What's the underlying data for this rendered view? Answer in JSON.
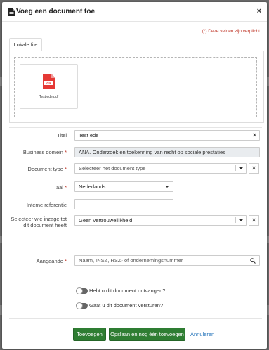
{
  "modal": {
    "title": "Voeg een document toe",
    "close_label": "×",
    "required_note": "(*) Deze velden zijn verplicht"
  },
  "tabs": [
    {
      "label": "Lokale file",
      "active": true
    }
  ],
  "upload": {
    "file_name": "Test ede.pdf",
    "file_badge": "PDF"
  },
  "form": {
    "titel": {
      "label": "Titel",
      "value": "Test ede",
      "clear": "×"
    },
    "business_domein": {
      "label": "Business domein",
      "required": "*",
      "value": "ANA. Onderzoek en toekenning van recht op sociale prestaties"
    },
    "document_type": {
      "label": "Document type",
      "required": "*",
      "placeholder": "Selecteer het document type",
      "clear": "×"
    },
    "taal": {
      "label": "Taal",
      "required": "*",
      "value": "Nederlands"
    },
    "interne_referentie": {
      "label": "Interne referentie",
      "value": ""
    },
    "inzage": {
      "label_line1": "Selecteer wie inzage tot",
      "label_line2": "dit document heeft",
      "value": "Geen vertrouwelijkheid",
      "clear": "×"
    },
    "aangaande": {
      "label": "Aangaande",
      "required": "*",
      "placeholder": "Naam, INSZ, RSZ- of ondernemingsnummer"
    }
  },
  "toggles": [
    {
      "label": "Hebt u dit document ontvangen?",
      "on": false
    },
    {
      "label": "Gaat u dit document versturen?",
      "on": false
    }
  ],
  "footer": {
    "add_label": "Toevoegen",
    "save_add_label": "Opslaan en nog één toevoegen",
    "cancel_label": "Annuleren"
  },
  "colors": {
    "primary_button": "#2e7d32",
    "required": "#c0392b",
    "link": "#1e6fb8",
    "pdf_red": "#e53935"
  }
}
